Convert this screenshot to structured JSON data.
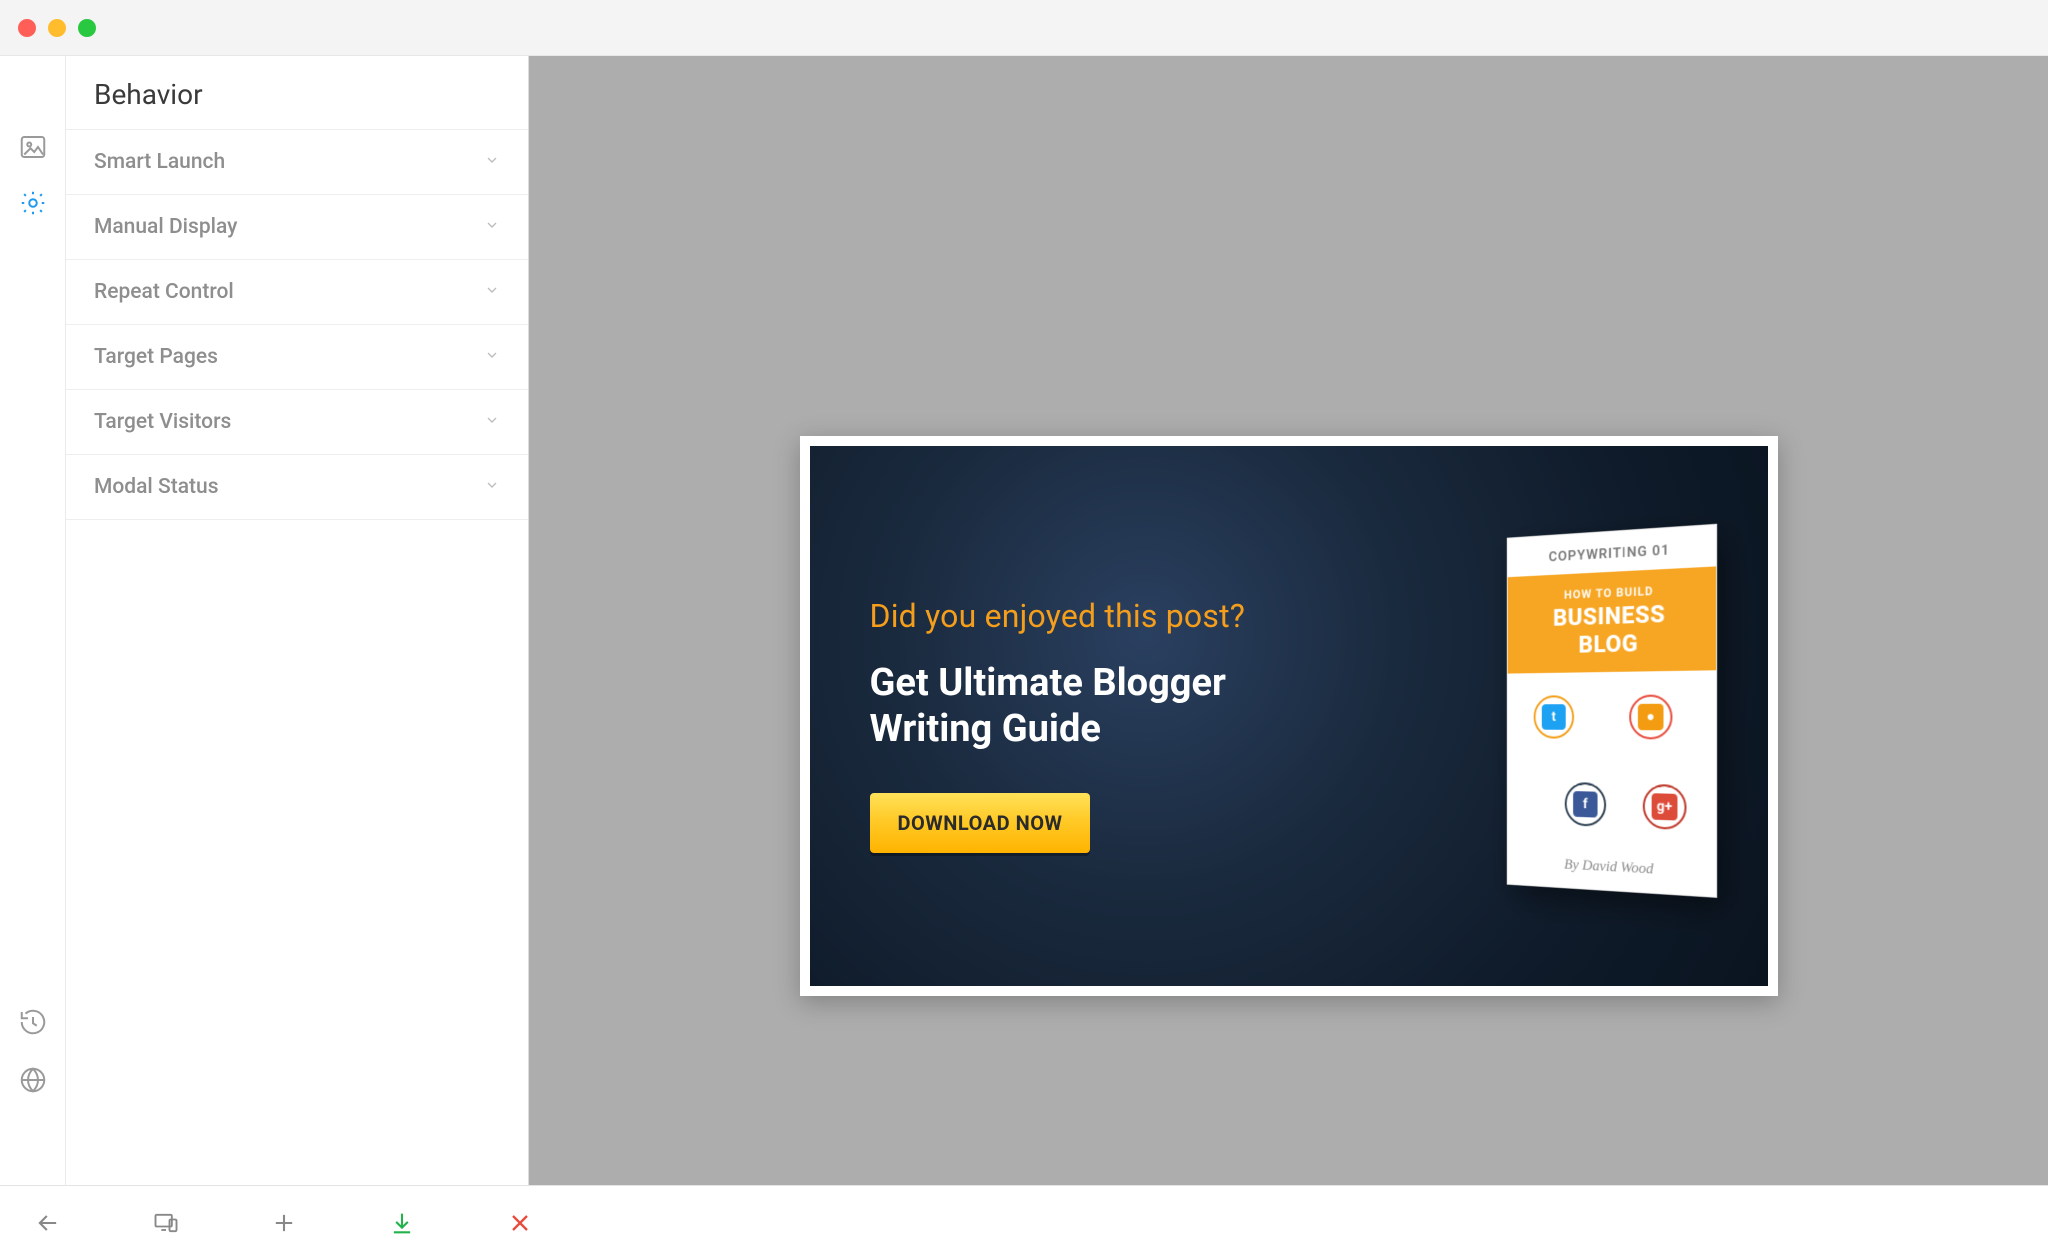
{
  "sidebar": {
    "title": "Behavior",
    "items": [
      {
        "label": "Smart Launch"
      },
      {
        "label": "Manual Display"
      },
      {
        "label": "Repeat Control"
      },
      {
        "label": "Target Pages"
      },
      {
        "label": "Target Visitors"
      },
      {
        "label": "Modal Status"
      }
    ]
  },
  "rail": {
    "image_icon": "image-icon",
    "settings_icon": "gear-icon",
    "history_icon": "history-icon",
    "globe_icon": "globe-icon"
  },
  "popup": {
    "lead": "Did you enjoyed this post?",
    "headline_line1": "Get Ultimate Blogger",
    "headline_line2": "Writing Guide",
    "cta": "DOWNLOAD NOW",
    "book": {
      "top_label": "COPYWRITING 01",
      "band_line1": "HOW TO BUILD",
      "band_line2": "BUSINESS",
      "band_line3": "BLOG",
      "author": "By David Wood",
      "social": {
        "twitter_glyph": "t",
        "rss_glyph": "●",
        "facebook_glyph": "f",
        "gplus_glyph": "g+"
      }
    }
  },
  "bottombar": {
    "back": "back",
    "devices": "devices",
    "add": "add",
    "save": "save",
    "close": "close"
  },
  "colors": {
    "canvas": "#adadad",
    "accent": "#f59e1b",
    "cta": "#ffca28"
  }
}
